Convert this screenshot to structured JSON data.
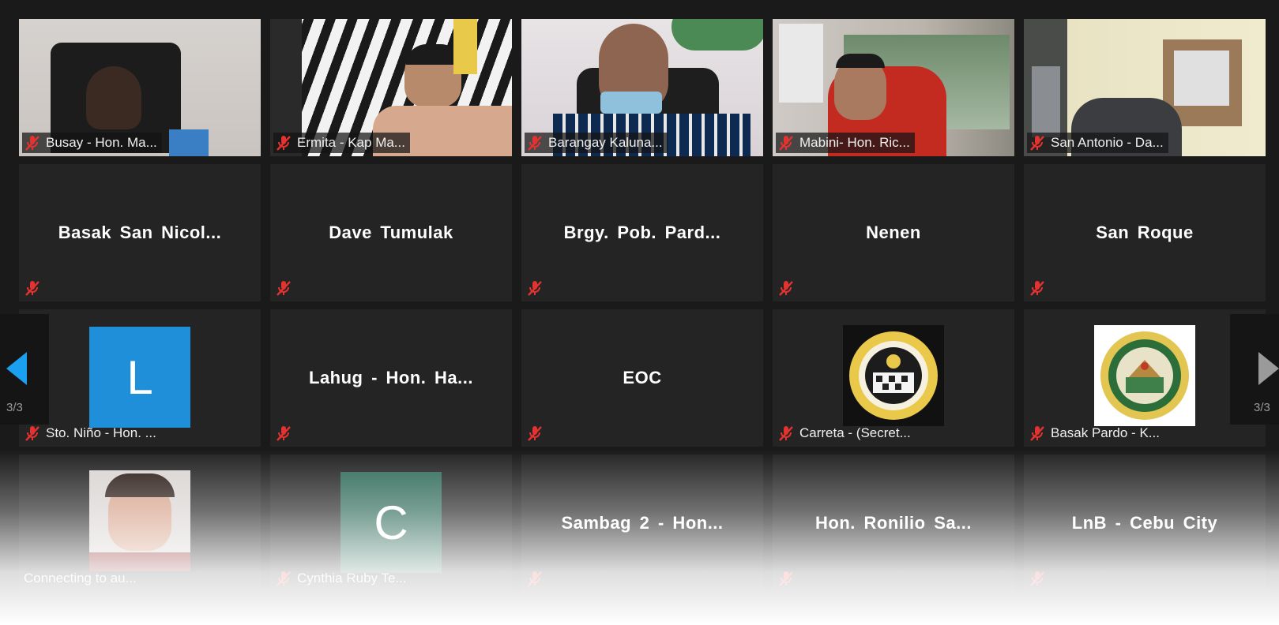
{
  "colors": {
    "background": "#1a1a1a",
    "tile": "#242424",
    "mute_red": "#e3322f",
    "accent_blue": "#1e8fd8",
    "avatar_green": "#2f6b59"
  },
  "tiles": [
    {
      "label": "Busay - Hon. Ma..."
    },
    {
      "label": "Ermita - Kap Ma..."
    },
    {
      "label": "Barangay Kaluna..."
    },
    {
      "label": "Mabini- Hon. Ric..."
    },
    {
      "label": "San Antonio - Da..."
    },
    {
      "center": "Basak San Nicol..."
    },
    {
      "center": "Dave Tumulak"
    },
    {
      "center": "Brgy. Pob. Pard..."
    },
    {
      "center": "Nenen"
    },
    {
      "center": "San Roque"
    },
    {
      "avatar_letter": "L",
      "label": "Sto. Niño - Hon. ..."
    },
    {
      "center": "Lahug - Hon. Ha..."
    },
    {
      "center": "EOC"
    },
    {
      "label": "Carreta - (Secret..."
    },
    {
      "label": "Basak Pardo - K..."
    },
    {
      "label": "Connecting to au..."
    },
    {
      "avatar_letter": "C",
      "label": "Cynthia Ruby Te..."
    },
    {
      "center": "Sambag 2 - Hon..."
    },
    {
      "center": "Hon. Ronilio Sa..."
    },
    {
      "center": "LnB - Cebu City"
    }
  ],
  "pagination": {
    "left": "3/3",
    "right": "3/3"
  },
  "icons": {
    "mute": "microphone-muted-icon",
    "prev": "previous-page-arrow-icon",
    "next": "next-page-arrow-icon"
  }
}
